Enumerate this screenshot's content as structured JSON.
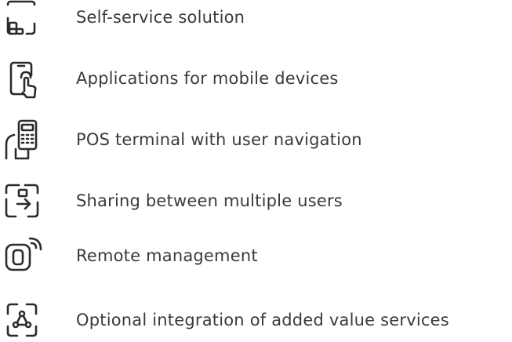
{
  "features": [
    {
      "icon": "self-service-icon",
      "label": "Self-service solution"
    },
    {
      "icon": "mobile-tap-icon",
      "label": "Applications for mobile devices"
    },
    {
      "icon": "pos-terminal-icon",
      "label": "POS terminal with user navigation"
    },
    {
      "icon": "share-device-icon",
      "label": "Sharing between multiple users"
    },
    {
      "icon": "remote-management-icon",
      "label": "Remote management"
    },
    {
      "icon": "integration-services-icon",
      "label": "Optional integration of added value services"
    }
  ]
}
